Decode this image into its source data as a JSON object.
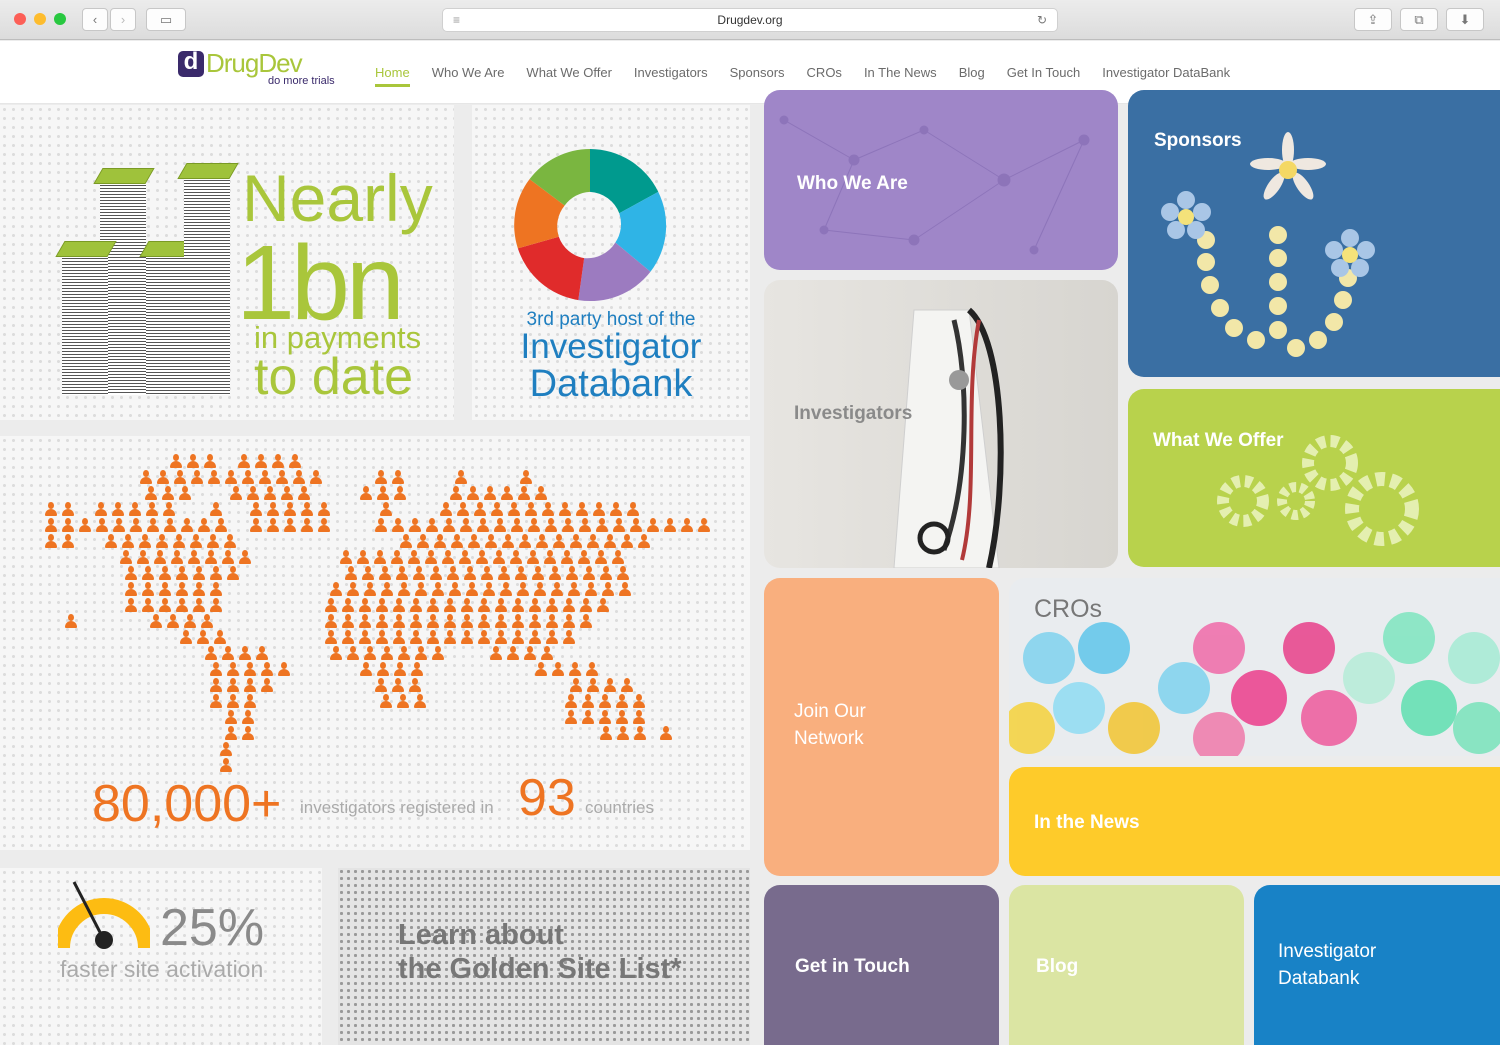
{
  "browser": {
    "url": "Drugdev.org",
    "traffic_lights": [
      "#fc5f57",
      "#fdbc2e",
      "#28c840"
    ]
  },
  "site": {
    "logo": {
      "letter": "d",
      "name": "DrugDev",
      "tagline": "do more trials"
    },
    "nav": [
      "Home",
      "Who We Are",
      "What We Offer",
      "Investigators",
      "Sponsors",
      "CROs",
      "In The News",
      "Blog",
      "Get In Touch",
      "Investigator DataBank"
    ],
    "active_nav": "Home",
    "colors": {
      "accent_green": "#a9c63b",
      "orange": "#ee7422",
      "blue": "#1f7fc0"
    }
  },
  "stats": {
    "payments": {
      "line1": "Nearly",
      "line2": "1bn",
      "line3": "in payments",
      "line4": "to date"
    },
    "databank": {
      "line1": "3rd party host of the",
      "line2": "Investigator",
      "line3": "Databank"
    },
    "investigators": {
      "count": "80,000+",
      "text": "investigators registered in",
      "countries": "93",
      "countries_label": "countries"
    },
    "activation": {
      "percent": "25%",
      "label": "faster site activation"
    },
    "golden": {
      "line1": "Learn about",
      "line2": "the Golden Site List*"
    }
  },
  "tiles": {
    "who_we_are": "Who We Are",
    "sponsors": "Sponsors",
    "investigators": "Investigators",
    "what_we_offer": "What We Offer",
    "join_network": "Join Our\nNetwork",
    "cros": "CROs",
    "in_the_news": "In the News",
    "get_in_touch": "Get in Touch",
    "blog": "Blog",
    "investigator_databank": "Investigator\nDatabank"
  }
}
